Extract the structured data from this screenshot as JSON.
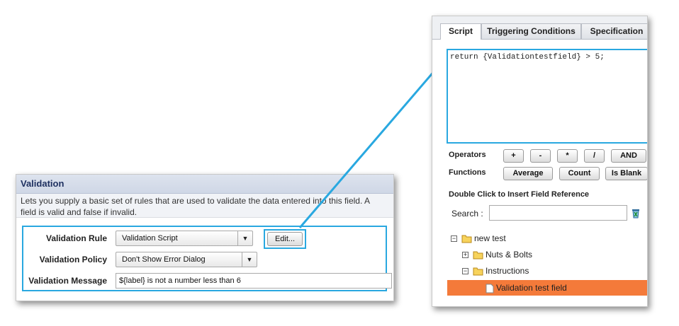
{
  "validation": {
    "title": "Validation",
    "description_line1": "Lets you supply a basic set of rules that are used to validate the data entered into this field. A",
    "description_line2": "field is valid and false if invalid.",
    "rule_label": "Validation Rule",
    "rule_value": "Validation Script",
    "edit_label": "Edit...",
    "policy_label": "Validation Policy",
    "policy_value": "Don't Show Error Dialog",
    "message_label": "Validation Message",
    "message_value": "${label} is not a number less than 6"
  },
  "editor": {
    "tabs": [
      "Script",
      "Triggering Conditions",
      "Specification"
    ],
    "active_tab": "Script",
    "code": "return {Validationtestfield}  > 5;",
    "operators_label": "Operators",
    "operators": [
      "+",
      "-",
      "*",
      "/",
      "AND"
    ],
    "functions_label": "Functions",
    "functions": [
      "Average",
      "Count",
      "Is Blank"
    ],
    "insert_ref_label": "Double Click to Insert Field Reference",
    "search_label": "Search :",
    "search_value": "",
    "tree": {
      "root": "new test",
      "children": [
        "Nuts & Bolts",
        "Instructions"
      ],
      "selected_leaf": "Validation test field"
    }
  },
  "colors": {
    "highlight": "#29a8e0",
    "selected_row": "#f47a3a",
    "header_text": "#1d2f5f"
  }
}
